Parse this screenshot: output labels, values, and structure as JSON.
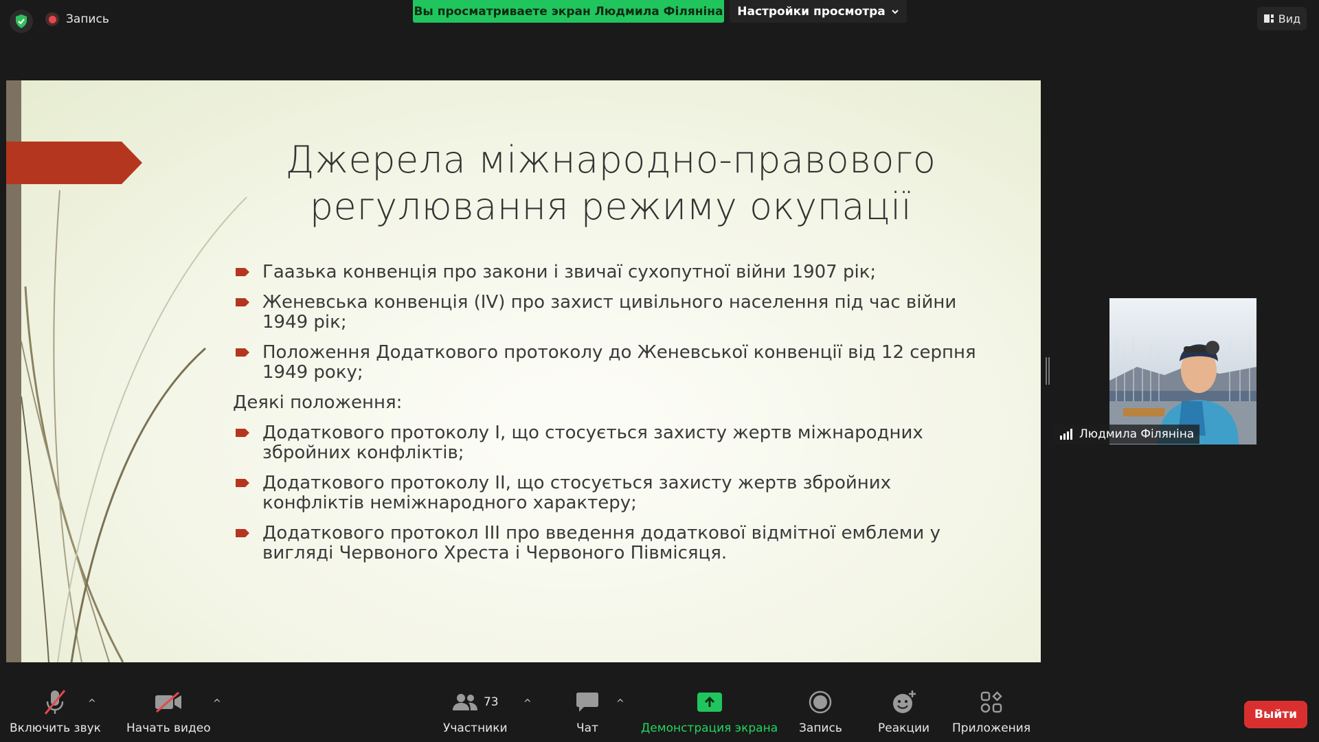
{
  "top": {
    "recording_label": "Запись",
    "viewing_banner": "Вы просматриваете экран Людмила Філяніна",
    "view_settings_label": "Настройки просмотра",
    "view_label": "Вид"
  },
  "slide": {
    "title_line1": "Джерела міжнародно-правового",
    "title_line2": "регулювання режиму окупації",
    "items": [
      "Гаазька конвенція про закони і звичаї сухопутної війни 1907 рік;",
      "Женевська конвенція (IV) про захист цивільного населення під час війни 1949 рік;",
      "Положення Додаткового протоколу до Женевської конвенції від 12 серпня 1949 року;"
    ],
    "subheading": "Деякі положення:",
    "subitems": [
      "Додаткового протоколу I, що стосується захисту жертв міжнародних збройних конфліктів;",
      "Додаткового протоколу II, що стосується захисту жертв збройних конфліктів неміжнародного характеру;",
      "Додаткового протокол III про введення додаткової відмітної емблеми у вигляді Червоного Хреста і Червоного Півмісяця."
    ],
    "colors": {
      "accent": "#b5361f",
      "strip": "#7d7261",
      "text": "#3a3a3a"
    }
  },
  "participant": {
    "name": "Людмила Філяніна"
  },
  "toolbar": {
    "unmute_label": "Включить звук",
    "start_video_label": "Начать видео",
    "participants_label": "Участники",
    "participants_count": "73",
    "chat_label": "Чат",
    "share_label": "Демонстрация экрана",
    "record_label": "Запись",
    "reactions_label": "Реакции",
    "apps_label": "Приложения",
    "exit_label": "Выйти"
  },
  "colors": {
    "share_green": "#21c55d",
    "exit_red": "#d9302f",
    "background": "#1a1a1a"
  }
}
